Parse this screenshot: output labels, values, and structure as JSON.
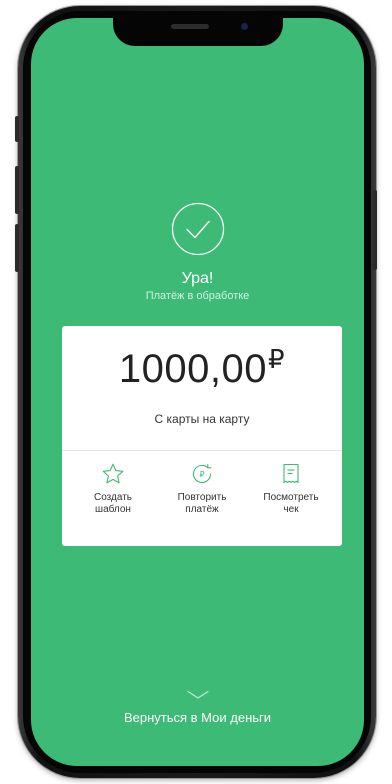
{
  "status": {
    "title": "Ура!",
    "subtitle": "Платёж в обработке"
  },
  "payment": {
    "amount": "1000,00",
    "currency": "₽",
    "description": "С карты на карту"
  },
  "actions": [
    {
      "line1": "Создать",
      "line2": "шаблон",
      "icon": "star-icon"
    },
    {
      "line1": "Повторить",
      "line2": "платёж",
      "icon": "repeat-payment-icon"
    },
    {
      "line1": "Посмотреть",
      "line2": "чек",
      "icon": "receipt-icon"
    }
  ],
  "footer": {
    "back_label": "Вернуться в Мои деньги"
  },
  "colors": {
    "accent": "#3cba76",
    "card": "#ffffff"
  }
}
